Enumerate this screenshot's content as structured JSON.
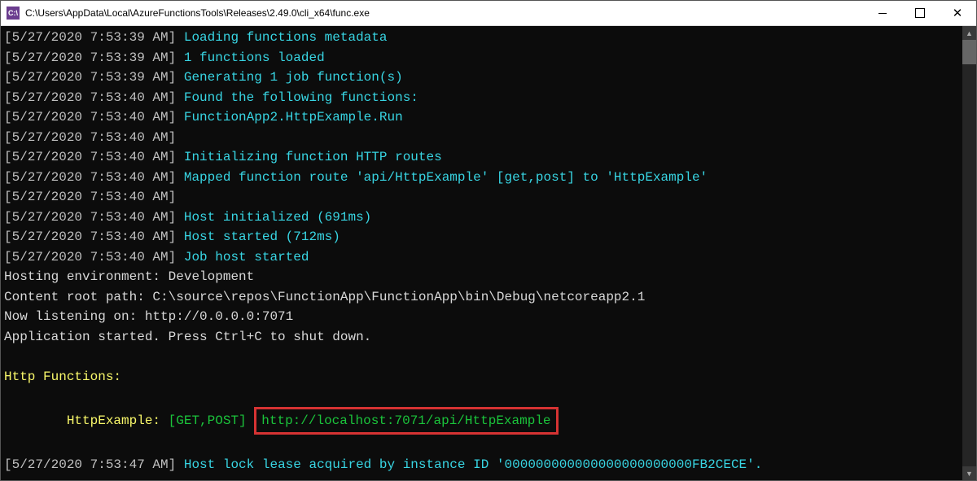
{
  "window": {
    "title": "C:\\Users\\AppData\\Local\\AzureFunctionsTools\\Releases\\2.49.0\\cli_x64\\func.exe",
    "icon_label": "C:\\"
  },
  "logs": [
    {
      "ts": "[5/27/2020 7:53:39 AM] ",
      "msg": "Loading functions metadata",
      "cls": "cyan"
    },
    {
      "ts": "[5/27/2020 7:53:39 AM] ",
      "msg": "1 functions loaded",
      "cls": "cyan"
    },
    {
      "ts": "[5/27/2020 7:53:39 AM] ",
      "msg": "Generating 1 job function(s)",
      "cls": "cyan"
    },
    {
      "ts": "[5/27/2020 7:53:40 AM] ",
      "msg": "Found the following functions:",
      "cls": "cyan"
    },
    {
      "ts": "[5/27/2020 7:53:40 AM] ",
      "msg": "FunctionApp2.HttpExample.Run",
      "cls": "cyan"
    },
    {
      "ts": "[5/27/2020 7:53:40 AM] ",
      "msg": "",
      "cls": "cyan"
    },
    {
      "ts": "[5/27/2020 7:53:40 AM] ",
      "msg": "Initializing function HTTP routes",
      "cls": "cyan"
    },
    {
      "ts": "[5/27/2020 7:53:40 AM] ",
      "msg": "Mapped function route 'api/HttpExample' [get,post] to 'HttpExample'",
      "cls": "cyan"
    },
    {
      "ts": "[5/27/2020 7:53:40 AM] ",
      "msg": "",
      "cls": "cyan"
    },
    {
      "ts": "[5/27/2020 7:53:40 AM] ",
      "msg": "Host initialized (691ms)",
      "cls": "cyan"
    },
    {
      "ts": "[5/27/2020 7:53:40 AM] ",
      "msg": "Host started (712ms)",
      "cls": "cyan"
    },
    {
      "ts": "[5/27/2020 7:53:40 AM] ",
      "msg": "Job host started",
      "cls": "cyan"
    }
  ],
  "plain": {
    "hosting": "Hosting environment: Development",
    "root": "Content root path: C:\\source\\repos\\FunctionApp\\FunctionApp\\bin\\Debug\\netcoreapp2.1",
    "listening": "Now listening on: http://0.0.0.0:7071",
    "started": "Application started. Press Ctrl+C to shut down."
  },
  "functions": {
    "header": "Http Functions:",
    "indent": "        ",
    "name": "HttpExample: ",
    "methods": "[GET,POST] ",
    "url": "http://localhost:7071/api/HttpExample"
  },
  "final": {
    "ts": "[5/27/2020 7:53:47 AM] ",
    "msg": "Host lock lease acquired by instance ID '000000000000000000000000FB2CECE'."
  }
}
